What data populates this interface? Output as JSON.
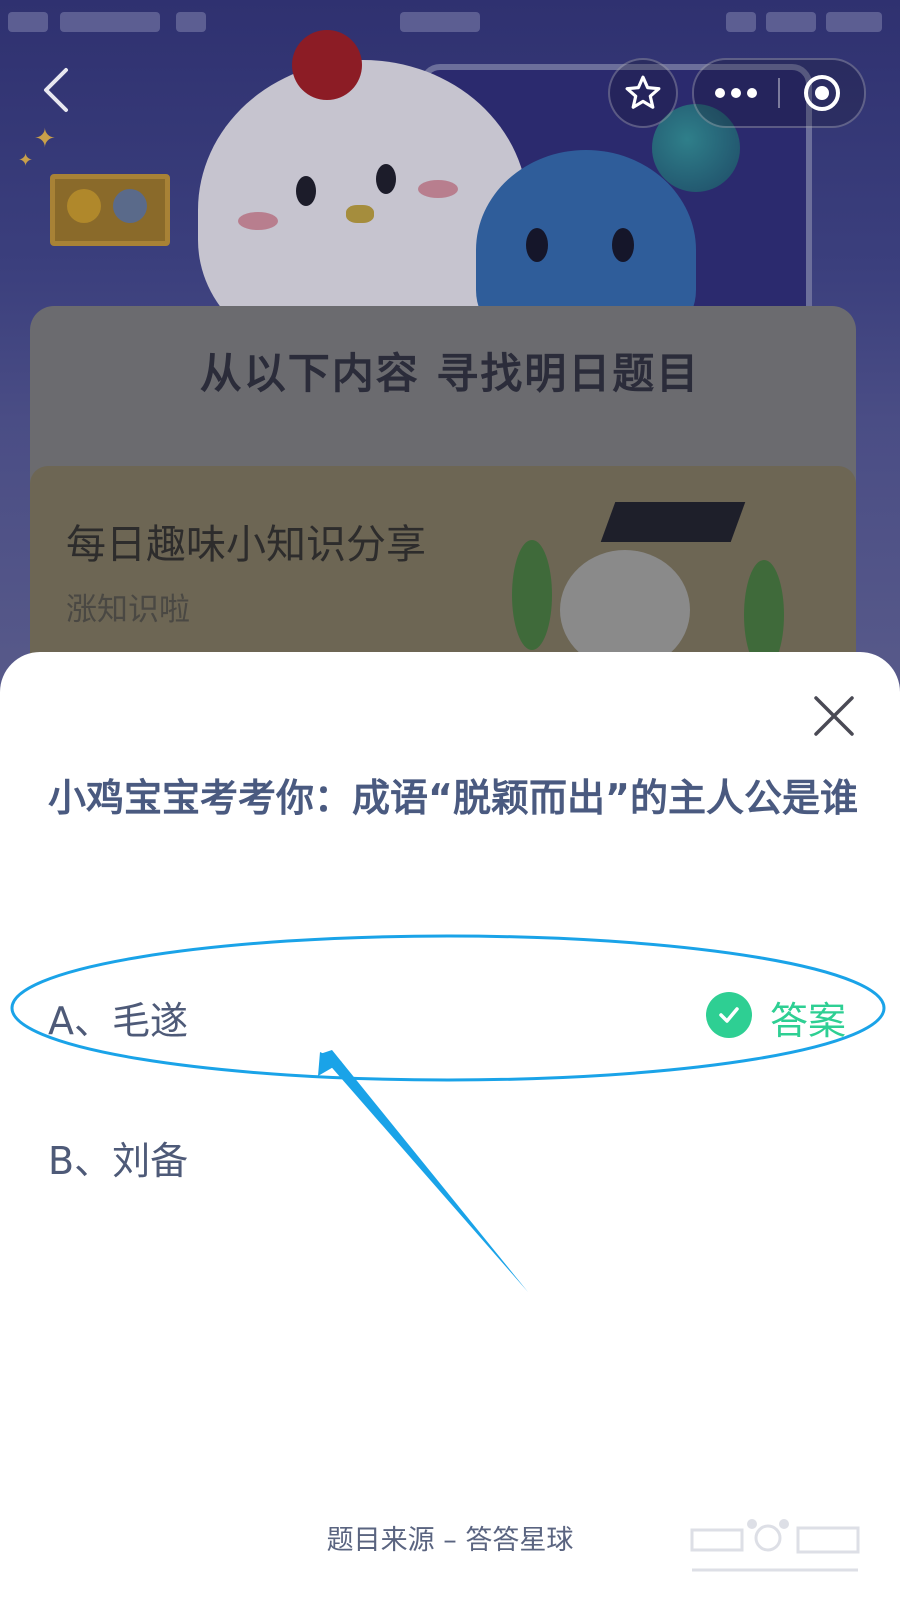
{
  "header": {
    "panel_title": "从以下内容 寻找明日题目"
  },
  "card": {
    "title": "每日趣味小知识分享",
    "subtitle": "涨知识啦"
  },
  "quiz": {
    "question": "小鸡宝宝考考你：成语“脱颖而出”的主人公是谁",
    "options": [
      {
        "label": "A、毛遂"
      },
      {
        "label": "B、刘备"
      }
    ],
    "answer_tag": "答案"
  },
  "footer": {
    "source": "题目来源 – 答答星球"
  },
  "colors": {
    "accent_green": "#2ecf93",
    "annotation_blue": "#1aa3e8",
    "question_text": "#4a5a80"
  },
  "icons": {
    "back": "chevron-left-icon",
    "favorite": "star-icon",
    "more": "more-dots-icon",
    "close_miniprogram": "target-circle-icon",
    "close_sheet": "close-icon",
    "answer": "check-circle-icon"
  }
}
